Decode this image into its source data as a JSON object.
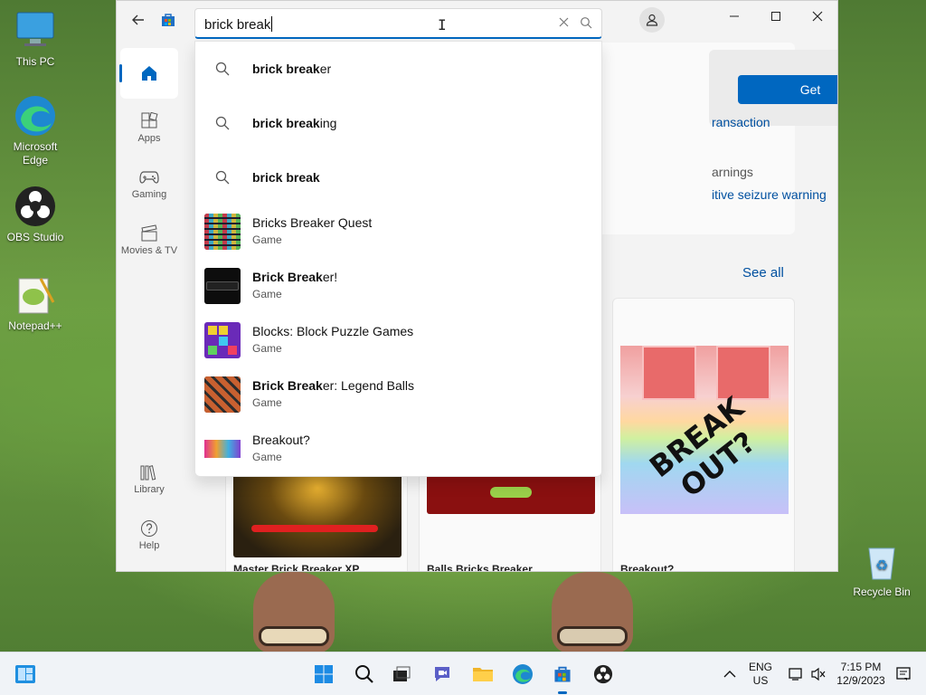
{
  "desktop": {
    "icons": [
      {
        "label": "This PC"
      },
      {
        "label": "Microsoft Edge"
      },
      {
        "label": "OBS Studio"
      },
      {
        "label": "Notepad++"
      },
      {
        "label": "Recycle Bin"
      }
    ]
  },
  "store": {
    "search": {
      "value": "brick break"
    },
    "nav": [
      {
        "label": "Home",
        "icon": "home-icon"
      },
      {
        "label": "Apps",
        "icon": "apps-icon"
      },
      {
        "label": "Gaming",
        "icon": "gamepad-icon"
      },
      {
        "label": "Movies & TV",
        "icon": "clapperboard-icon"
      },
      {
        "label": "Library",
        "icon": "library-icon"
      },
      {
        "label": "Help",
        "icon": "help-icon"
      }
    ],
    "suggestions": [
      {
        "bold": "brick break",
        "rest": "er"
      },
      {
        "bold": "brick break",
        "rest": "ing"
      },
      {
        "bold": "brick break",
        "rest": ""
      }
    ],
    "results": [
      {
        "pre": "",
        "bold": "",
        "rest": "Bricks Breaker Quest",
        "type": "Game"
      },
      {
        "pre": "",
        "bold": "Brick Break",
        "rest": "er!",
        "type": "Game"
      },
      {
        "pre": "",
        "bold": "",
        "rest": "Blocks: Block Puzzle Games",
        "type": "Game"
      },
      {
        "pre": "",
        "bold": "Brick Break",
        "rest": "er: Legend Balls",
        "type": "Game"
      },
      {
        "pre": "",
        "bold": "",
        "rest": "Breakout?",
        "type": "Game"
      }
    ],
    "get_label": "Get",
    "fragments": {
      "transaction": "ransaction",
      "warnings": "arnings",
      "seizure": "itive seizure warning"
    },
    "see_all": "See all",
    "cards": [
      {
        "title": "Master Brick Breaker XP"
      },
      {
        "title": "Balls Bricks Breaker"
      },
      {
        "title": "Breakout?"
      }
    ],
    "breakout_art": "BREAK OUT?"
  },
  "taskbar": {
    "lang_top": "ENG",
    "lang_bottom": "US",
    "time": "7:15 PM",
    "date": "12/9/2023"
  },
  "colors": {
    "accent": "#0067c0"
  }
}
